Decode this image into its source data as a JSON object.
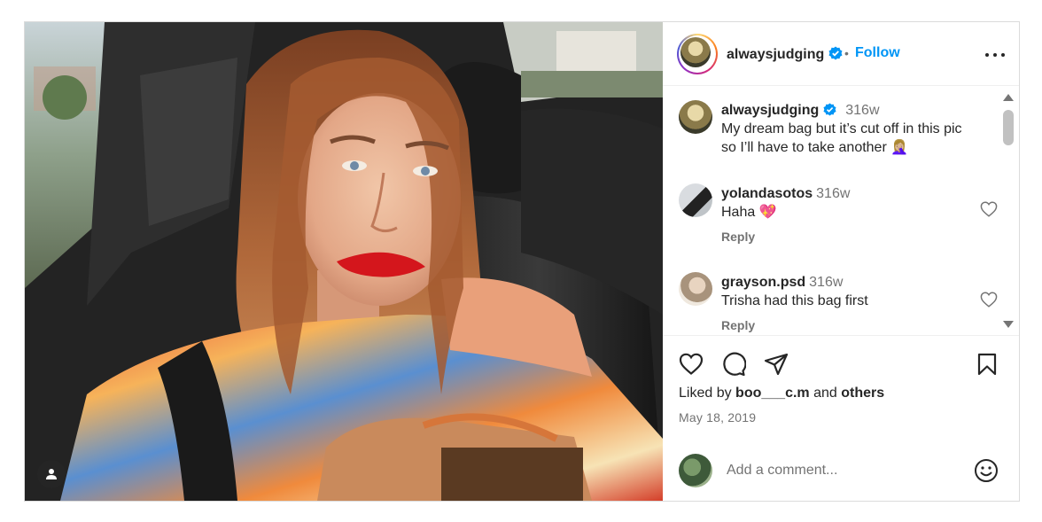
{
  "post": {
    "username": "alwaysjudging",
    "follow_label": "Follow",
    "separator": "•",
    "more_label": "More options"
  },
  "comments": [
    {
      "username": "alwaysjudging",
      "verified": true,
      "time": "316w",
      "text": "My dream bag but it’s cut off in this pic so I’ll have to take another 🤦🏼‍♀️",
      "text_line1": "My dream bag but it’s cut off in this pic",
      "text_line2": "so I’ll have to take another 🤦🏼‍♀️"
    },
    {
      "username": "yolandasotos",
      "time": "316w",
      "text": "Haha 💖",
      "reply_label": "Reply"
    },
    {
      "username": "grayson.psd",
      "time": "316w",
      "text": "Trisha had this bag first",
      "reply_label": "Reply"
    }
  ],
  "likes": {
    "prefix": "Liked by ",
    "liker": "boo___c.m",
    "middle": " and ",
    "others": "others"
  },
  "date": "May 18, 2019",
  "add_comment": {
    "placeholder": "Add a comment..."
  },
  "icons": {
    "like": "heart-icon",
    "comment": "comment-icon",
    "share": "share-icon",
    "save": "bookmark-icon",
    "emoji": "emoji-icon",
    "verified": "verified-badge-icon",
    "user_tag": "user-tag-icon"
  },
  "colors": {
    "accent": "#0095f6",
    "verified": "#0095f6",
    "text": "#262626",
    "muted": "#737373",
    "border": "#dbdbdb",
    "lips": "#d4161c"
  }
}
